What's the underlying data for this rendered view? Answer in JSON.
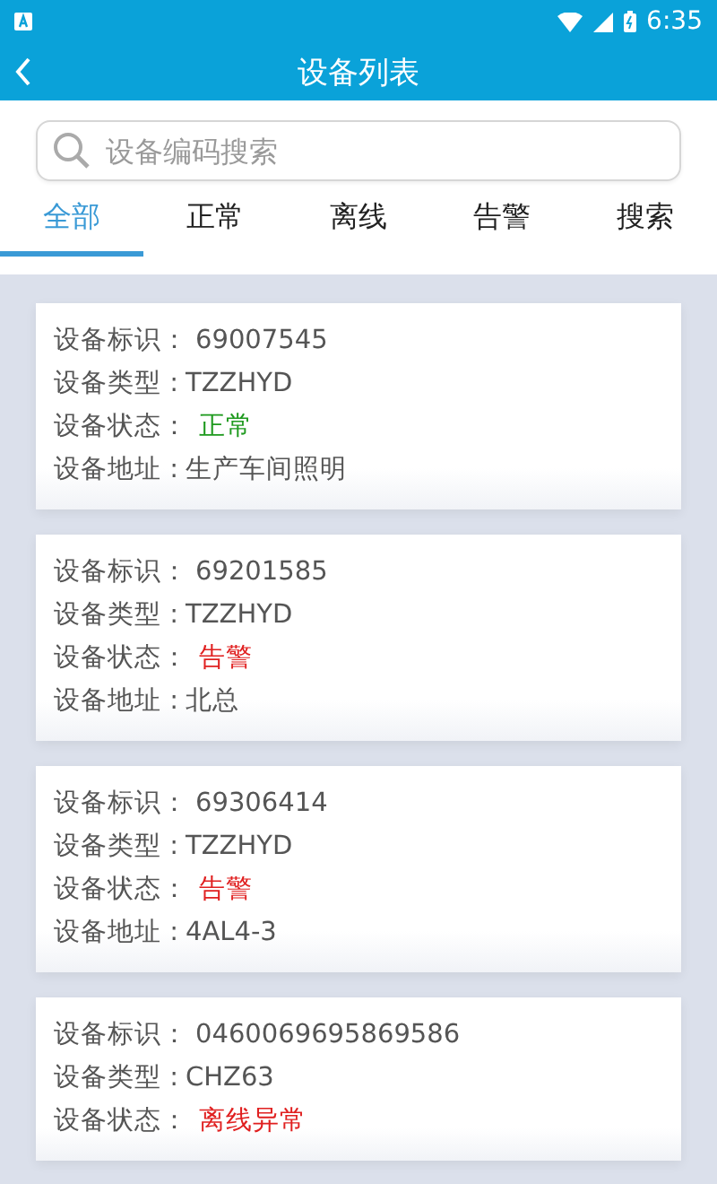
{
  "status_bar": {
    "time": "6:35"
  },
  "header": {
    "title": "设备列表"
  },
  "search": {
    "placeholder": "设备编码搜索"
  },
  "tabs": [
    {
      "label": "全部",
      "selected": true
    },
    {
      "label": "正常",
      "selected": false
    },
    {
      "label": "离线",
      "selected": false
    },
    {
      "label": "告警",
      "selected": false
    },
    {
      "label": "搜索",
      "selected": false
    }
  ],
  "devices": [
    {
      "id_label": "设备标识：",
      "id": "69007545",
      "type_label": "设备类型 :",
      "type": "TZZHYD",
      "status_label": "设备状态：",
      "status": "正常",
      "color": "#1f9a1f",
      "address_label": "设备地址 :",
      "address": "生产车间照明"
    },
    {
      "id_label": "设备标识：",
      "id": "69201585",
      "type_label": "设备类型 :",
      "type": "TZZHYD",
      "status_label": "设备状态：",
      "status": "告警",
      "color": "#e02020",
      "address_label": "设备地址 :",
      "address": "北总"
    },
    {
      "id_label": "设备标识：",
      "id": "69306414",
      "type_label": "设备类型 :",
      "type": "TZZHYD",
      "status_label": "设备状态：",
      "status": "告警",
      "color": "#e02020",
      "address_label": "设备地址 :",
      "address": "4AL4-3"
    },
    {
      "id_label": "设备标识：",
      "id": "0460069695869586",
      "type_label": "设备类型 :",
      "type": "CHZ63",
      "status_label": "设备状态：",
      "status": "离线异常",
      "color": "#e02020"
    }
  ]
}
